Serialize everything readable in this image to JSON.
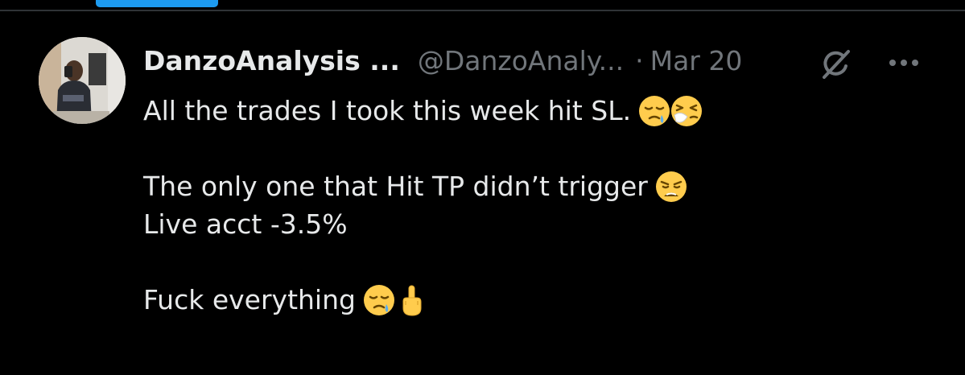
{
  "tweet": {
    "author": {
      "display_name": "DanzoAnalysis ...",
      "handle": "@DanzoAnaly...",
      "avatar_icon": "profile-photo"
    },
    "separator": "·",
    "date": "Mar 20",
    "actions": {
      "grok_icon": "grok-icon",
      "more_icon": "more-options-icon"
    },
    "lines": [
      "All the trades I took this week hit SL.",
      "",
      "The only one that Hit TP didn’t trigger",
      "Live acct -3.5%",
      "",
      "Fuck everything"
    ],
    "emojis": {
      "line1": [
        "sleepy-face",
        "sneezing-face"
      ],
      "line3": [
        "weary-face"
      ],
      "line6": [
        "sleepy-face",
        "middle-finger"
      ]
    }
  },
  "colors": {
    "background": "#000000",
    "text": "#e7e9ea",
    "secondary": "#71767b",
    "accent": "#1d9bf0",
    "divider": "#2f3336"
  }
}
